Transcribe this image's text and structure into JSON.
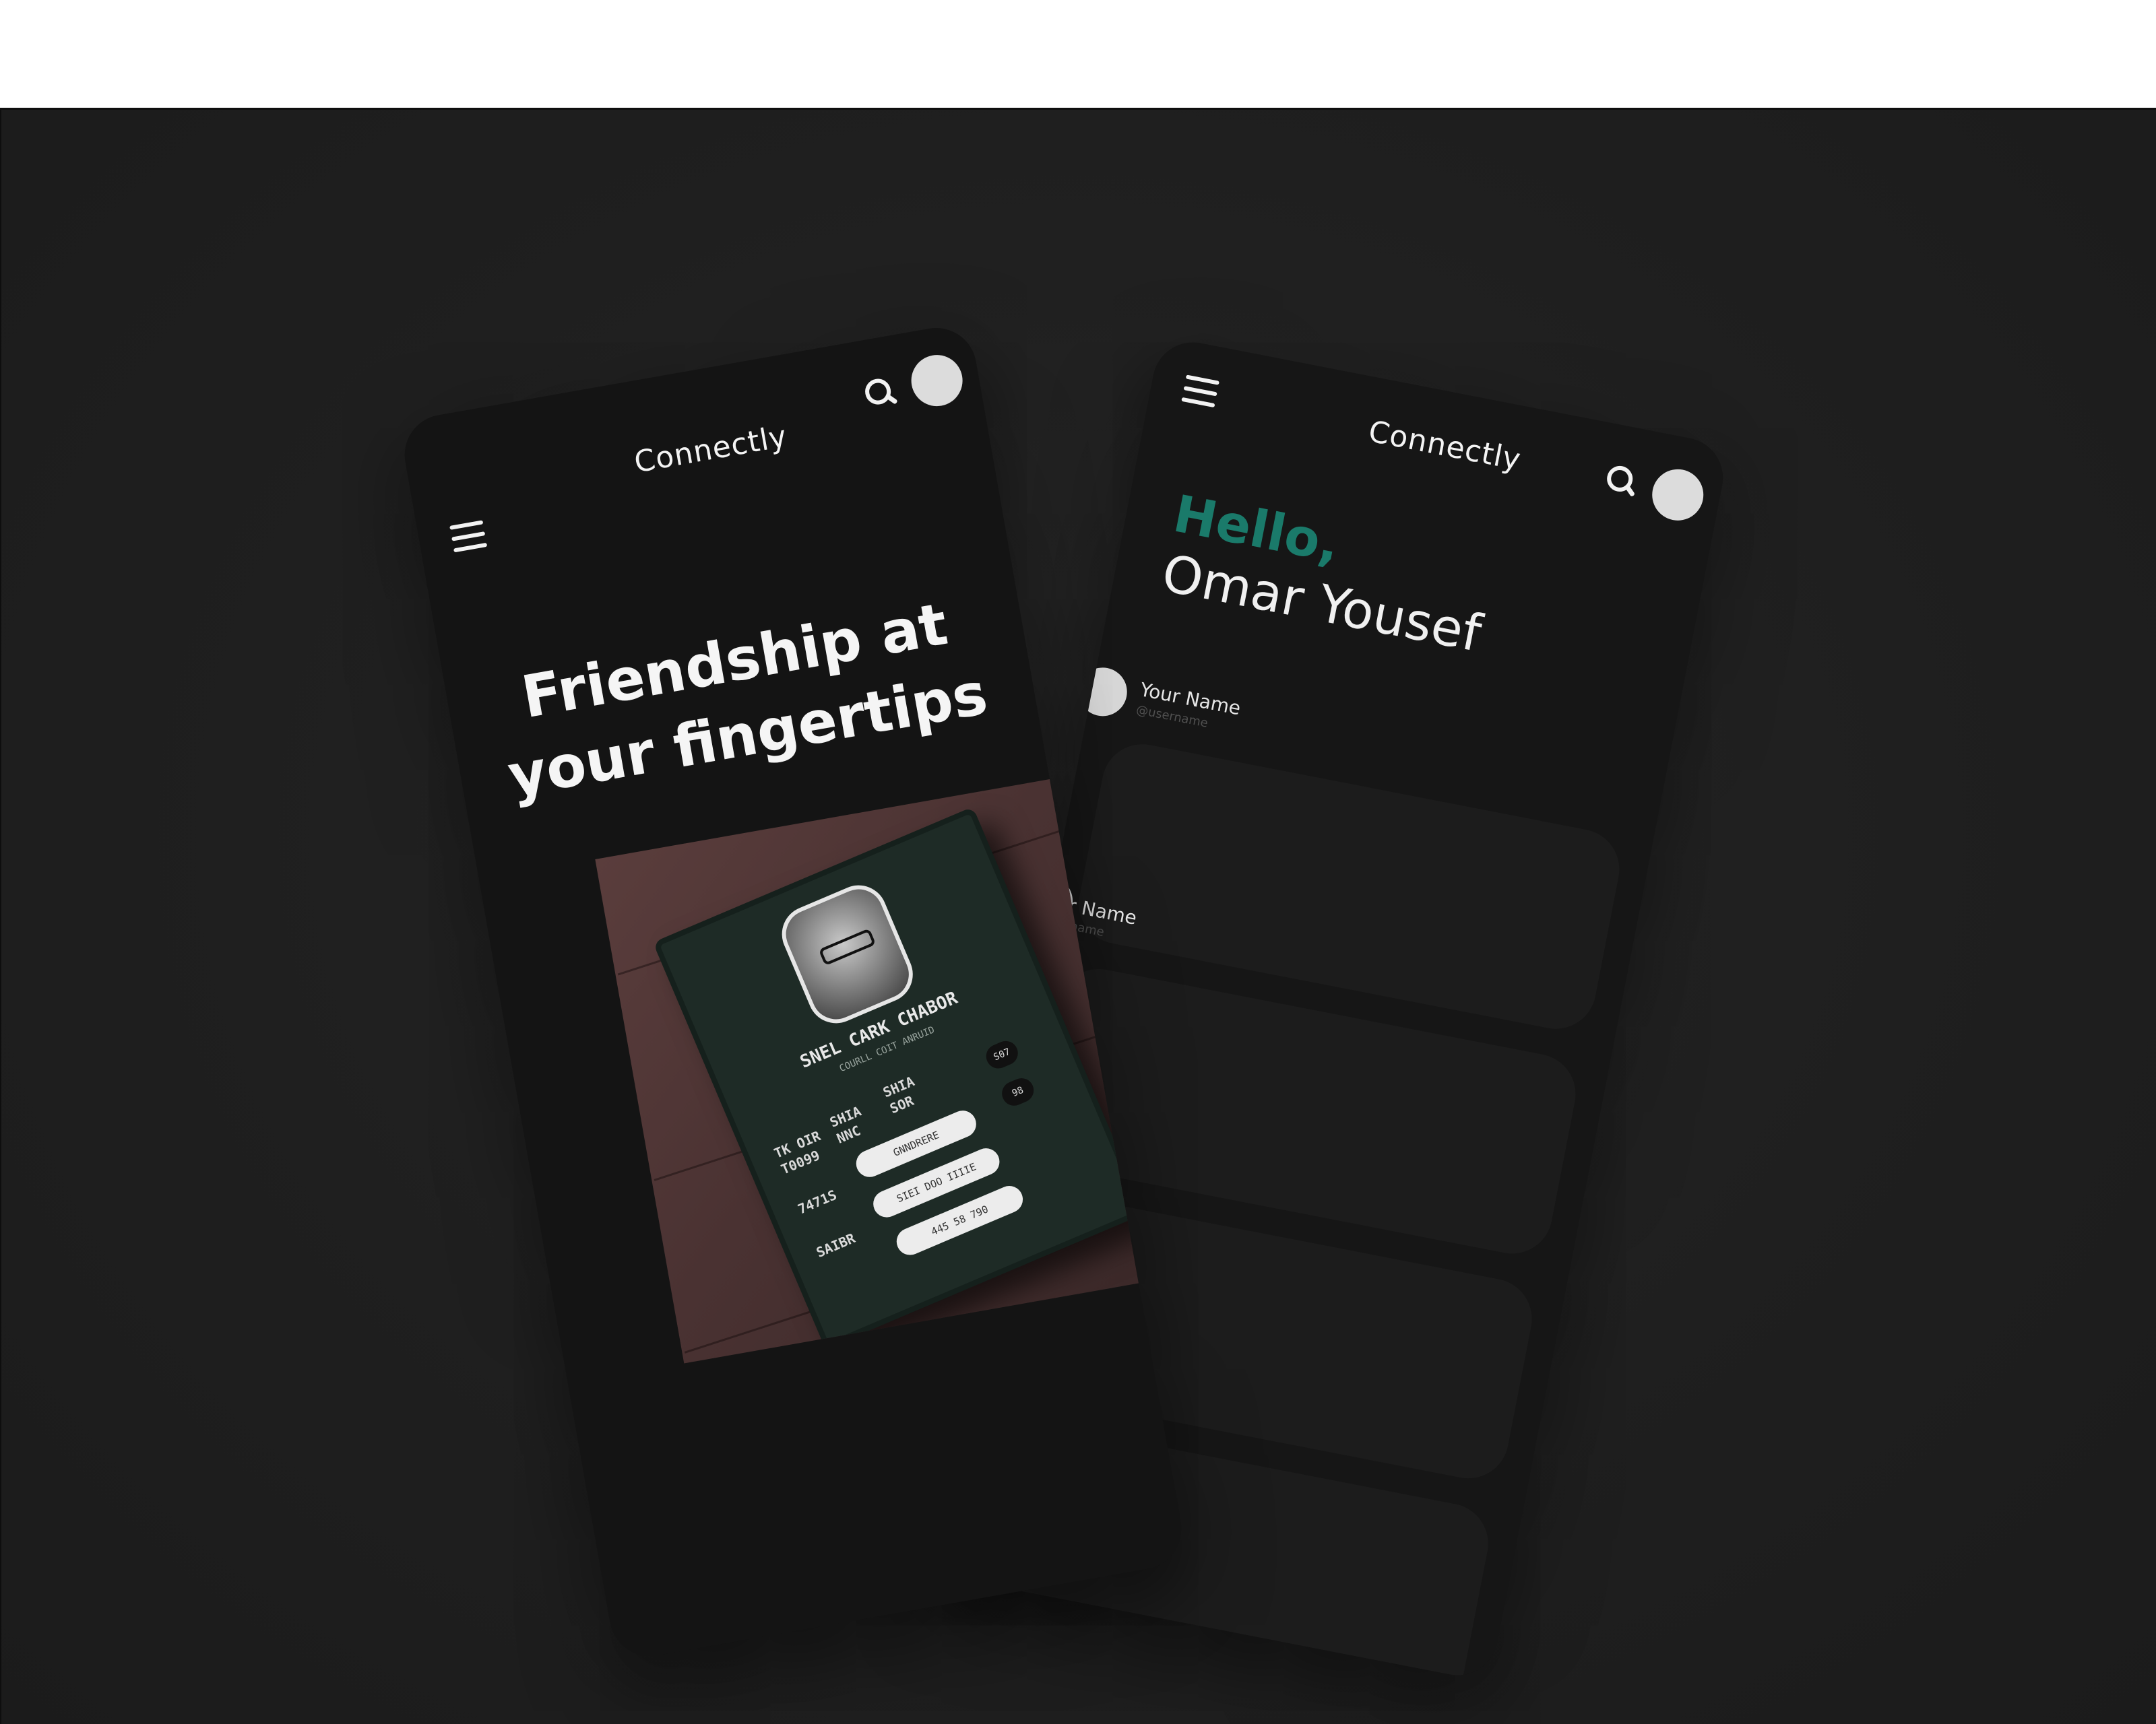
{
  "right_screen": {
    "brand": "Connectly",
    "greeting": "Hello,",
    "user_name": "Omar Yousef",
    "profiles": [
      {
        "name": "Your Name",
        "username": "@username"
      },
      {
        "name": "Your Name",
        "username": "@username"
      }
    ]
  },
  "left_screen": {
    "brand": "Connectly",
    "hero_line1": "Friendship at",
    "hero_line2": "your fingertips",
    "device_card": {
      "name": "SNEL CARK CHABOR",
      "subtitle": "COURLL COIT ANRUID",
      "labels": [
        "TK OIR",
        "T0099",
        "SHIA",
        "NNC",
        "SHIA",
        "SOR",
        "7471S",
        "SAIBR"
      ],
      "pills": [
        "GNNDRERE",
        "SIEI DOO IIIIE",
        "445 58 790"
      ],
      "knobs": [
        "S07",
        "98"
      ]
    }
  },
  "colors": {
    "background": "#1f1f1f",
    "phone": "#141414",
    "accent": "#1a7a6a",
    "text": "#f4f4f4"
  },
  "icons": [
    "menu-icon",
    "search-icon",
    "avatar"
  ]
}
